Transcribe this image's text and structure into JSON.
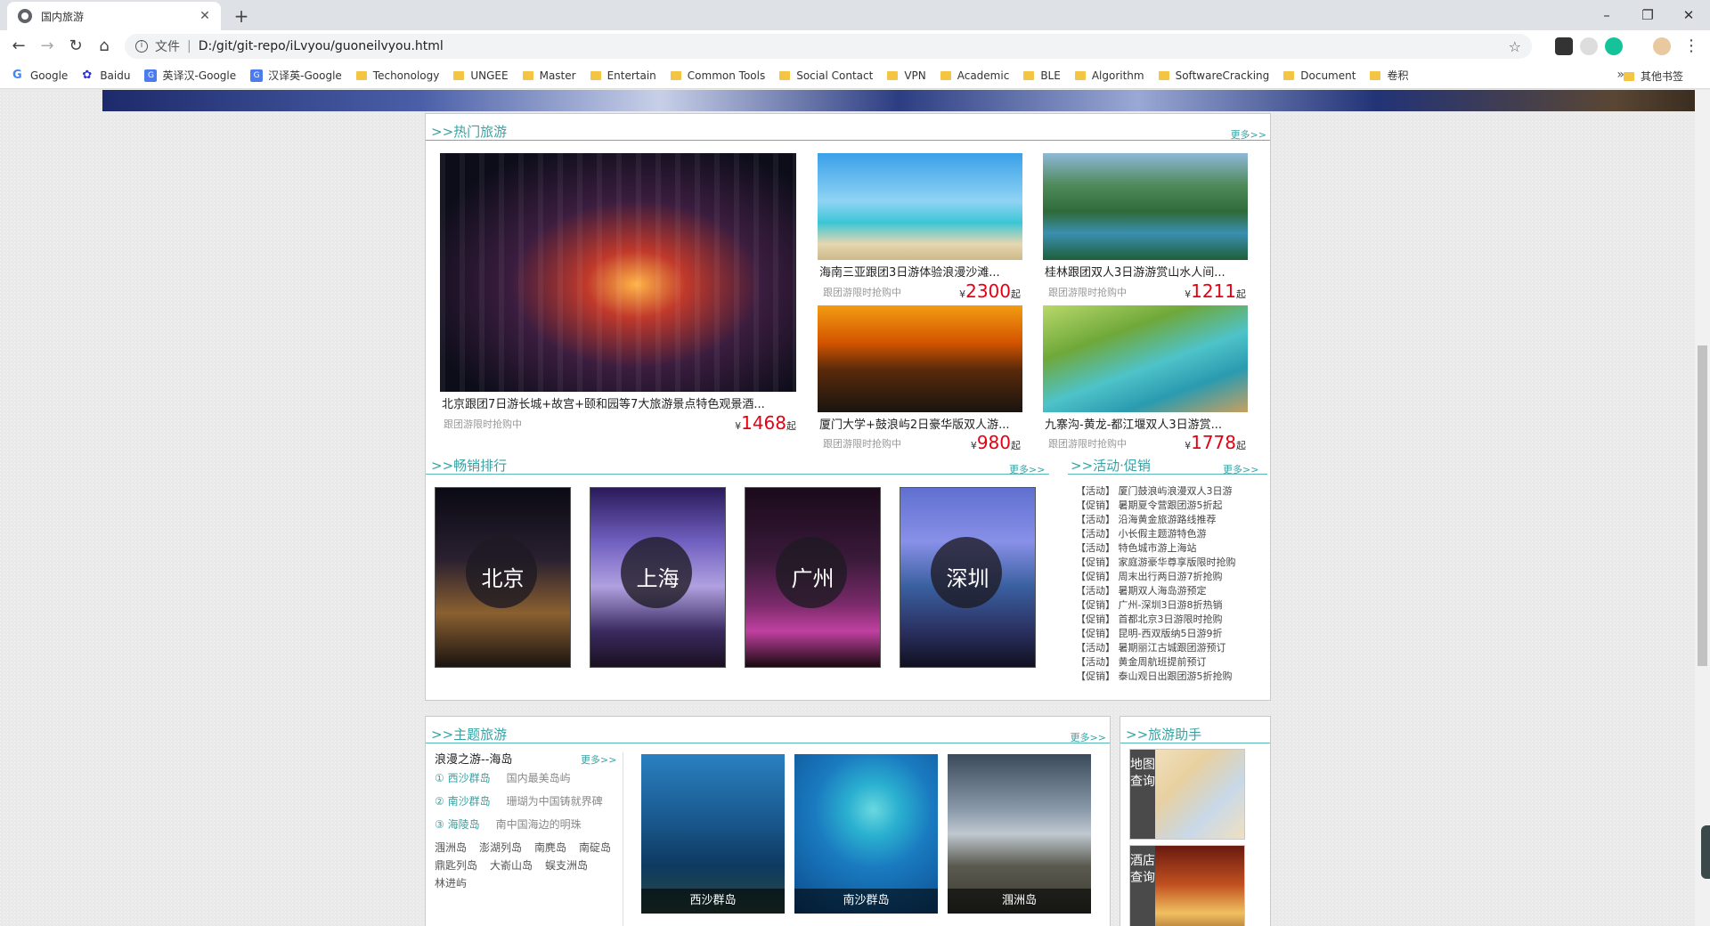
{
  "browser": {
    "tab_title": "国内旅游",
    "scheme_label": "文件",
    "separator": "|",
    "url": "D:/git/git-repo/iLvyou/guoneilvyou.html",
    "bookmarks": [
      "Google",
      "Baidu",
      "英译汉-Google",
      "汉译英-Google",
      "Techonology",
      "UNGEE",
      "Master",
      "Entertain",
      "Common Tools",
      "Social Contact",
      "VPN",
      "Academic",
      "BLE",
      "Algorithm",
      "SoftwareCracking",
      "Document",
      "卷积"
    ],
    "bookmarks_more": "»",
    "other_bookmarks": "其他书签"
  },
  "hot": {
    "title": ">>热门旅游",
    "more": "更多>>",
    "big": {
      "caption": "北京跟团7日游长城+故宫+颐和园等7大旅游景点特色观景酒...",
      "note": "跟团游限时抢购中",
      "yen": "¥",
      "price": "1468",
      "qi": "起"
    },
    "items": [
      {
        "caption": "海南三亚跟团3日游体验浪漫沙滩...",
        "note": "跟团游限时抢购中",
        "yen": "¥",
        "price": "2300",
        "qi": "起"
      },
      {
        "caption": "桂林跟团双人3日游游赏山水人间...",
        "note": "跟团游限时抢购中",
        "yen": "¥",
        "price": "1211",
        "qi": "起"
      },
      {
        "caption": "厦门大学+鼓浪屿2日豪华版双人游...",
        "note": "跟团游限时抢购中",
        "yen": "¥",
        "price": "980",
        "qi": "起"
      },
      {
        "caption": "九寨沟-黄龙-都江堰双人3日游赏...",
        "note": "跟团游限时抢购中",
        "yen": "¥",
        "price": "1778",
        "qi": "起"
      }
    ]
  },
  "ranking": {
    "title": ">>畅销排行",
    "more": "更多>>",
    "cities": [
      "北京",
      "上海",
      "广州",
      "深圳"
    ]
  },
  "promo": {
    "title": ">>活动·促销",
    "more": "更多>>",
    "items": [
      "【活动】 厦门鼓浪屿浪漫双人3日游",
      "【促销】 暑期夏令营跟团游5折起",
      "【活动】 沿海黄金旅游路线推荐",
      "【活动】 小长假主题游特色游",
      "【活动】 特色城市游上海站",
      "【促销】 家庭游豪华尊享版限时抢购",
      "【促销】 周末出行两日游7折抢购",
      "【活动】 暑期双人海岛游预定",
      "【促销】 广州-深圳3日游8折热销",
      "【促销】 首都北京3日游限时抢购",
      "【促销】 昆明-西双版纳5日游9折",
      "【活动】 暑期丽江古城跟团游预订",
      "【活动】 黄金周航班提前预订",
      "【促销】 泰山观日出跟团游5折抢购"
    ]
  },
  "theme": {
    "title": ">>主题旅游",
    "more": "更多>>",
    "subtitle": "浪漫之游--海岛",
    "sub_more": "更多>>",
    "list": [
      {
        "name": "① 西沙群岛",
        "desc": "国内最美岛屿"
      },
      {
        "name": "② 南沙群岛",
        "desc": "珊瑚为中国铸就界碑"
      },
      {
        "name": "③ 海陵岛",
        "desc": "南中国海边的明珠"
      }
    ],
    "isles_row1": [
      "涠洲岛",
      "澎湖列岛",
      "南麂岛",
      "南碇岛"
    ],
    "isles_row2": [
      "鼎匙列岛",
      "大嵛山岛",
      "蜈支洲岛"
    ],
    "isles_row3": [
      "林进屿"
    ],
    "photos": [
      "西沙群岛",
      "南沙群岛",
      "涠洲岛"
    ]
  },
  "helper": {
    "title": ">>旅游助手",
    "items": [
      "地图查询",
      "酒店查询"
    ]
  }
}
